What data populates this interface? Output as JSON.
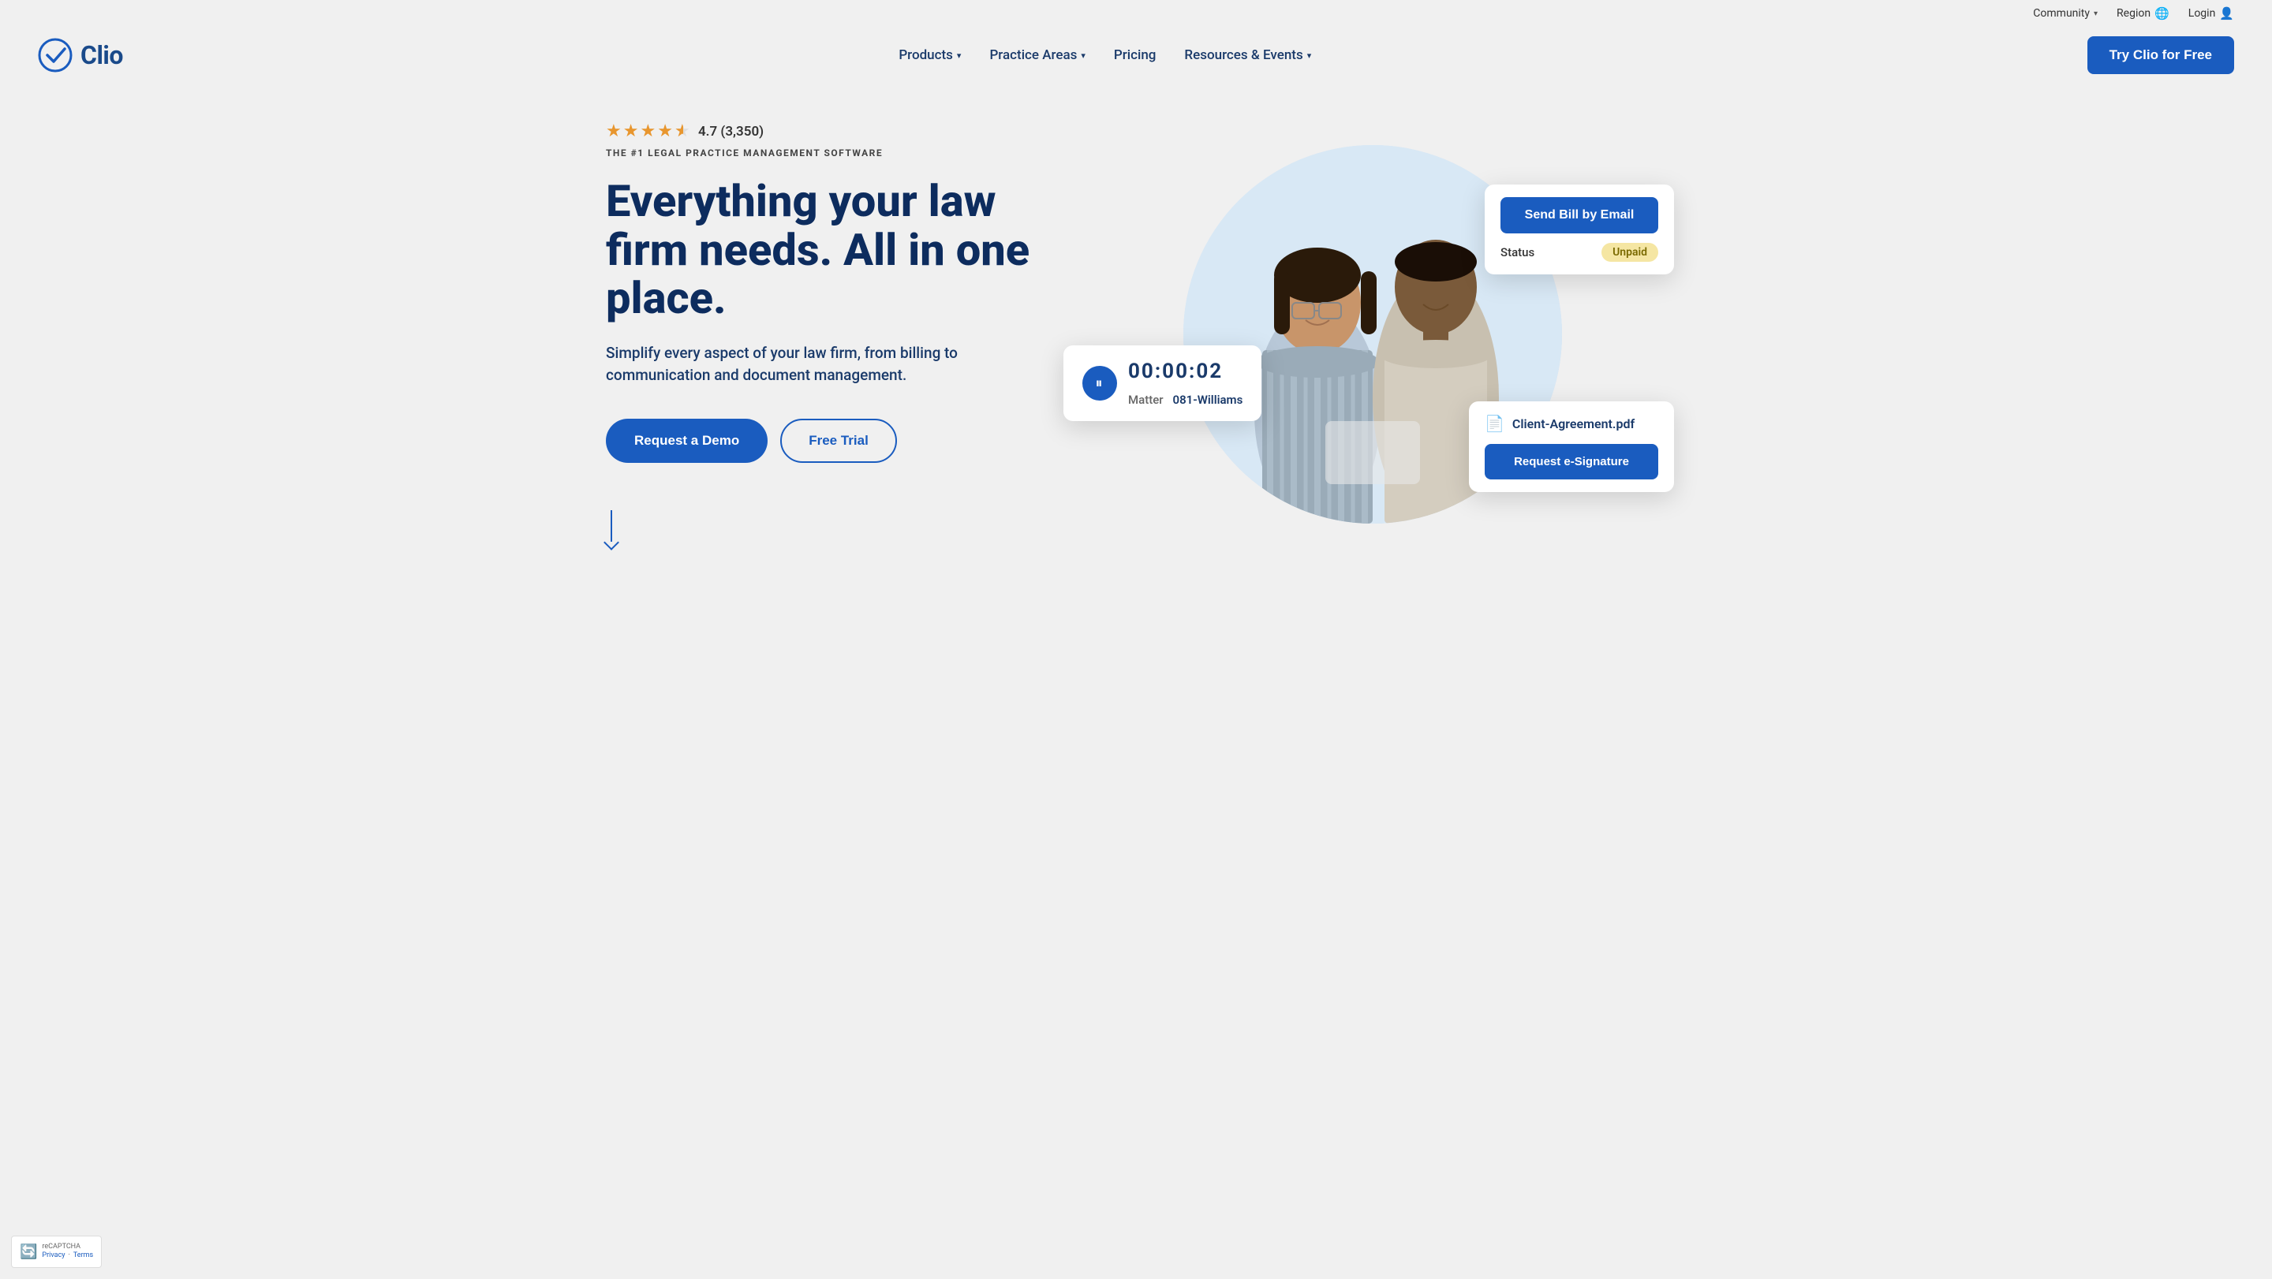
{
  "topbar": {
    "community_label": "Community",
    "region_label": "Region",
    "login_label": "Login"
  },
  "nav": {
    "logo_text": "Clio",
    "products_label": "Products",
    "practice_areas_label": "Practice Areas",
    "pricing_label": "Pricing",
    "resources_label": "Resources & Events",
    "cta_label": "Try Clio for Free"
  },
  "hero": {
    "rating_value": "4.7 (3,350)",
    "tagline": "THE #1 LEGAL PRACTICE MANAGEMENT SOFTWARE",
    "headline_line1": "Everything your law",
    "headline_line2": "firm needs. All in one",
    "headline_line3": "place.",
    "subtext": "Simplify every aspect of your law firm, from billing to communication and document management.",
    "btn_demo": "Request a Demo",
    "btn_trial": "Free Trial"
  },
  "timer_card": {
    "time": "00:00:02",
    "matter_label": "Matter",
    "matter_value": "081-Williams"
  },
  "bill_card": {
    "button_label": "Send Bill by Email",
    "status_label": "Status",
    "status_value": "Unpaid"
  },
  "doc_card": {
    "doc_name": "Client-Agreement.pdf",
    "esig_label": "Request e-Signature"
  },
  "recaptcha": {
    "privacy_label": "Privacy",
    "terms_label": "Terms"
  }
}
